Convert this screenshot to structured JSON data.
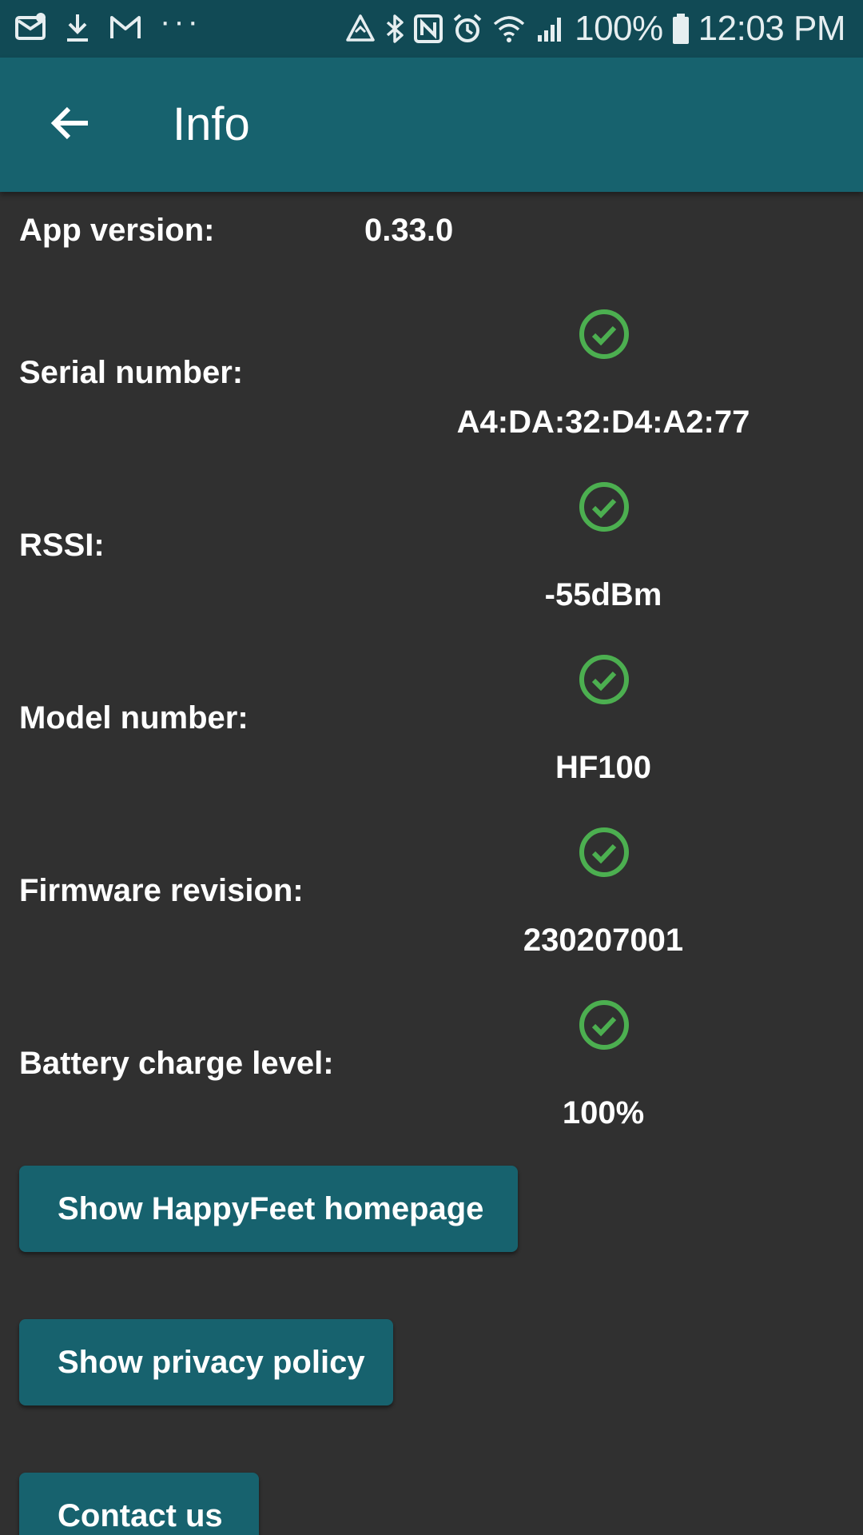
{
  "status_bar": {
    "battery_percent": "100%",
    "time": "12:03 PM",
    "overflow_dots": "···",
    "left_icons": [
      "mail-icon",
      "download-icon",
      "gmail-icon"
    ],
    "right_icons": [
      "data-saver-icon",
      "bluetooth-icon",
      "nfc-icon",
      "alarm-icon",
      "wifi-icon",
      "signal-icon",
      "battery-icon"
    ]
  },
  "app_bar": {
    "title": "Info",
    "back_icon": "arrow-left-icon"
  },
  "info": {
    "app_version": {
      "label": "App version:",
      "value": "0.33.0"
    },
    "rows": [
      {
        "label": "Serial number:",
        "value": "A4:DA:32:D4:A2:77",
        "status_icon": "check-circle-icon"
      },
      {
        "label": "RSSI:",
        "value": "-55dBm",
        "status_icon": "check-circle-icon"
      },
      {
        "label": "Model number:",
        "value": "HF100",
        "status_icon": "check-circle-icon"
      },
      {
        "label": "Firmware revision:",
        "value": "230207001",
        "status_icon": "check-circle-icon"
      },
      {
        "label": "Battery charge level:",
        "value": "100%",
        "status_icon": "check-circle-icon"
      }
    ]
  },
  "buttons": {
    "homepage": "Show HappyFeet homepage",
    "privacy": "Show privacy policy",
    "contact": "Contact us"
  },
  "colors": {
    "status_bar": "#114a55",
    "app_bar": "#17626e",
    "background": "#303030",
    "check": "#4caf50",
    "button": "#17626e"
  }
}
